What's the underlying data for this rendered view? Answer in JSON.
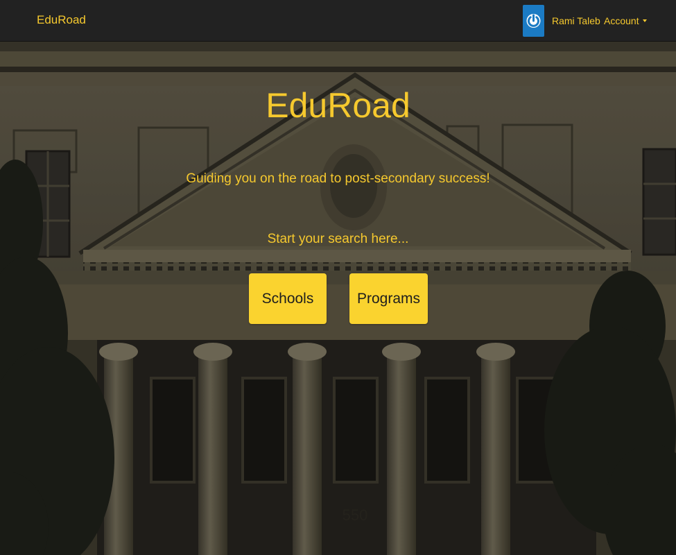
{
  "navbar": {
    "brand": "EduRoad",
    "user_name": "Rami Taleb",
    "account_label": "Account"
  },
  "icons": {
    "avatar": "power-icon",
    "account_caret": "caret-down-icon"
  },
  "hero": {
    "title": "EduRoad",
    "tagline": "Guiding you on the road to post-secondary success!",
    "prompt": "Start your search here...",
    "buttons": {
      "schools": "Schools",
      "programs": "Programs"
    },
    "building_number": "550"
  },
  "colors": {
    "accent": "#f6c92e",
    "button_bg": "#fad32f",
    "navbar_bg": "#222222",
    "avatar_bg": "#1b7bc4"
  }
}
